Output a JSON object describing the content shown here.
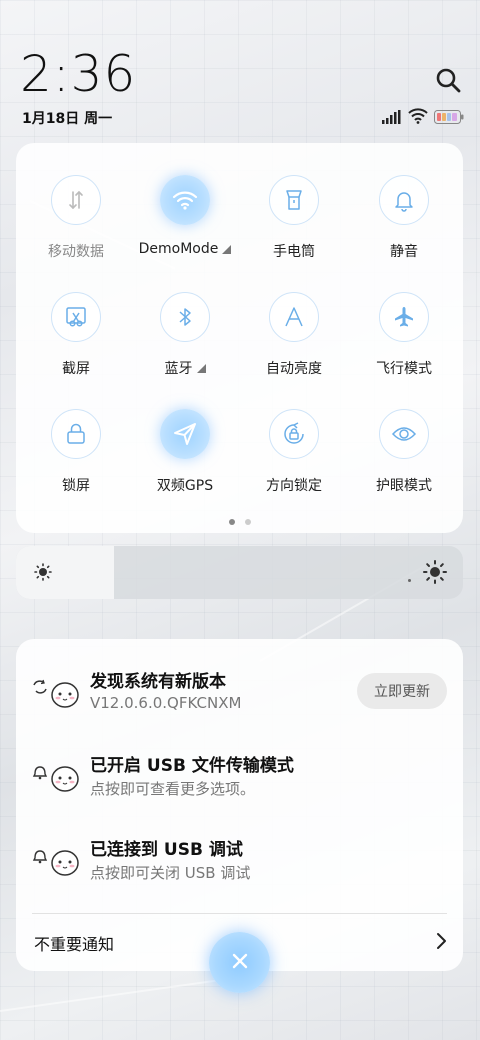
{
  "status_bar": {
    "time": "2:36",
    "date": "1月18日 周一",
    "icons": [
      "signal-icon",
      "wifi-icon",
      "battery-icon"
    ]
  },
  "header": {
    "search_icon": "search-icon"
  },
  "quick_settings": {
    "tiles": [
      {
        "label": "移动数据",
        "icon": "mobile-data-icon",
        "active": false,
        "dimmed": true,
        "has_arrow": false
      },
      {
        "label": "DemoMode",
        "icon": "wifi-icon",
        "active": true,
        "dimmed": false,
        "has_arrow": true
      },
      {
        "label": "手电筒",
        "icon": "flashlight-icon",
        "active": false,
        "dimmed": false,
        "has_arrow": false
      },
      {
        "label": "静音",
        "icon": "bell-icon",
        "active": false,
        "dimmed": false,
        "has_arrow": false
      },
      {
        "label": "截屏",
        "icon": "screenshot-icon",
        "active": false,
        "dimmed": false,
        "has_arrow": false
      },
      {
        "label": "蓝牙",
        "icon": "bluetooth-icon",
        "active": false,
        "dimmed": false,
        "has_arrow": true
      },
      {
        "label": "自动亮度",
        "icon": "auto-brightness-icon",
        "active": false,
        "dimmed": false,
        "has_arrow": false
      },
      {
        "label": "飞行模式",
        "icon": "airplane-icon",
        "active": false,
        "dimmed": false,
        "has_arrow": false
      },
      {
        "label": "锁屏",
        "icon": "lock-icon",
        "active": false,
        "dimmed": false,
        "has_arrow": false
      },
      {
        "label": "双频GPS",
        "icon": "gps-icon",
        "active": true,
        "dimmed": false,
        "has_arrow": false
      },
      {
        "label": "方向锁定",
        "icon": "rotation-lock-icon",
        "active": false,
        "dimmed": false,
        "has_arrow": false
      },
      {
        "label": "护眼模式",
        "icon": "eye-icon",
        "active": false,
        "dimmed": false,
        "has_arrow": false
      }
    ],
    "pages": 2,
    "current_page": 1
  },
  "brightness": {
    "level": 0.22
  },
  "notifications": {
    "items": [
      {
        "title": "发现系统有新版本",
        "subtitle": "V12.0.6.0.QFKCNXM",
        "icon": "sync-icon",
        "action": "立即更新"
      },
      {
        "title": "已开启 USB 文件传输模式",
        "subtitle": "点按即可查看更多选项。",
        "icon": "bell-icon"
      },
      {
        "title": "已连接到 USB 调试",
        "subtitle": "点按即可关闭 USB 调试",
        "icon": "bell-icon"
      }
    ],
    "unimportant_label": "不重要通知"
  },
  "fab": {
    "icon": "close-icon"
  },
  "colors": {
    "accent": "#5aa9f0",
    "tile_border": "#cfe4f8"
  }
}
